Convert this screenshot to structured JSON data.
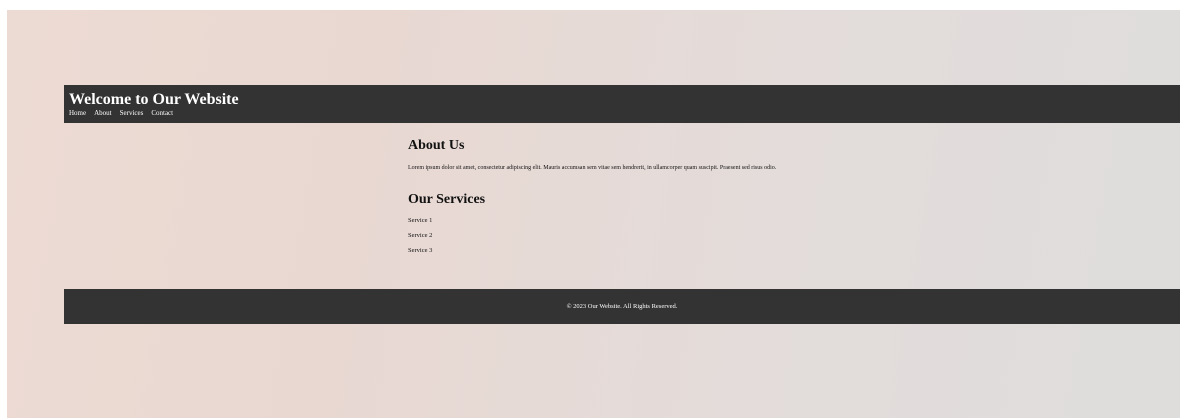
{
  "header": {
    "title": "Welcome to Our Website",
    "nav": [
      "Home",
      "About",
      "Services",
      "Contact"
    ]
  },
  "about": {
    "title": "About Us",
    "text": "Lorem ipsum dolor sit amet, consectetur adipiscing elit. Mauris accumsan sem vitae sem hendrerit, in ullamcorper quam suscipit. Praesent sed risus odio."
  },
  "services": {
    "title": "Our Services",
    "items": [
      "Service 1",
      "Service 2",
      "Service 3"
    ]
  },
  "footer": {
    "text": "© 2023 Our Website. All Rights Reserved."
  },
  "colors": {
    "header_bg": "#333333",
    "footer_bg": "#333333"
  }
}
